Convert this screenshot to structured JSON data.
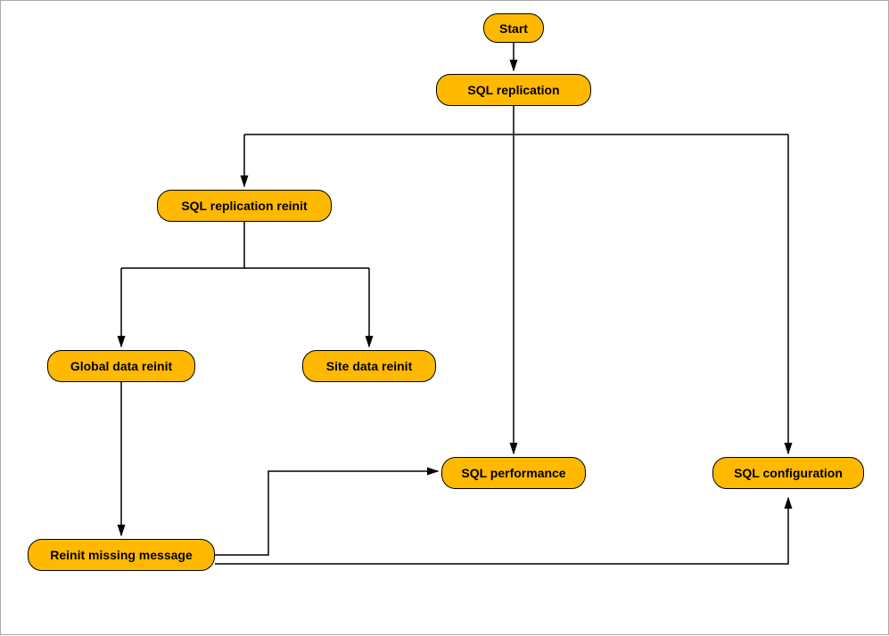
{
  "nodes": {
    "start": "Start",
    "sql_replication": "SQL replication",
    "sql_replication_reinit": "SQL replication reinit",
    "global_data_reinit": "Global data reinit",
    "site_data_reinit": "Site data reinit",
    "reinit_missing_message": "Reinit missing message",
    "sql_performance": "SQL performance",
    "sql_configuration": "SQL configuration"
  },
  "chart_data": {
    "type": "flowchart",
    "title": "",
    "nodes": [
      {
        "id": "start",
        "label": "Start",
        "shape": "rounded-rect"
      },
      {
        "id": "sql_replication",
        "label": "SQL replication",
        "shape": "rounded-rect"
      },
      {
        "id": "sql_replication_reinit",
        "label": "SQL replication reinit",
        "shape": "rounded-rect"
      },
      {
        "id": "global_data_reinit",
        "label": "Global data reinit",
        "shape": "rounded-rect"
      },
      {
        "id": "site_data_reinit",
        "label": "Site data reinit",
        "shape": "rounded-rect"
      },
      {
        "id": "reinit_missing_message",
        "label": "Reinit missing message",
        "shape": "rounded-rect"
      },
      {
        "id": "sql_performance",
        "label": "SQL performance",
        "shape": "rounded-rect"
      },
      {
        "id": "sql_configuration",
        "label": "SQL configuration",
        "shape": "rounded-rect"
      }
    ],
    "edges": [
      {
        "from": "start",
        "to": "sql_replication"
      },
      {
        "from": "sql_replication",
        "to": "sql_replication_reinit"
      },
      {
        "from": "sql_replication",
        "to": "sql_performance"
      },
      {
        "from": "sql_replication",
        "to": "sql_configuration"
      },
      {
        "from": "sql_replication_reinit",
        "to": "global_data_reinit"
      },
      {
        "from": "sql_replication_reinit",
        "to": "site_data_reinit"
      },
      {
        "from": "global_data_reinit",
        "to": "reinit_missing_message"
      },
      {
        "from": "reinit_missing_message",
        "to": "sql_performance"
      },
      {
        "from": "reinit_missing_message",
        "to": "sql_configuration"
      }
    ]
  }
}
